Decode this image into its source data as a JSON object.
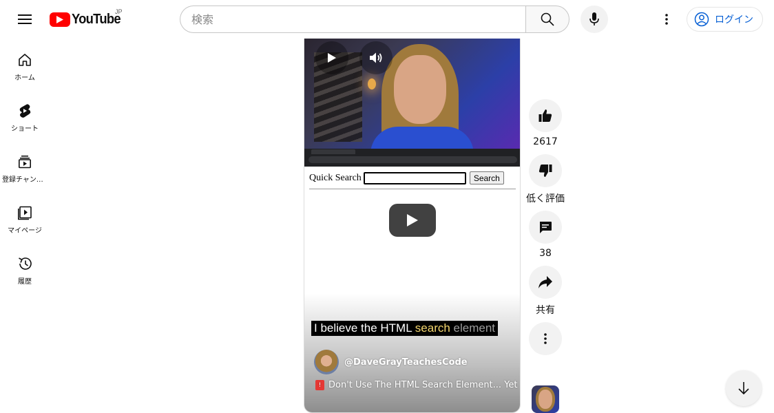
{
  "header": {
    "logo_text": "YouTube",
    "region": "JP",
    "search": {
      "placeholder": "検索",
      "value": ""
    },
    "login_label": "ログイン"
  },
  "sidebar": {
    "items": [
      {
        "label": "ホーム",
        "icon": "home-icon"
      },
      {
        "label": "ショート",
        "icon": "shorts-icon"
      },
      {
        "label": "登録チャンネル",
        "icon": "subscriptions-icon"
      },
      {
        "label": "マイページ",
        "icon": "library-icon"
      },
      {
        "label": "履歴",
        "icon": "history-icon"
      }
    ]
  },
  "player": {
    "embedded_page": {
      "label": "Quick Search",
      "button": "Search"
    },
    "caption": {
      "part1": "I believe the HTML ",
      "part2": "search",
      "part3": " element"
    },
    "channel": "@DaveGrayTeachesCode",
    "title": "Don't Use The HTML Search Element... Yet"
  },
  "actions": {
    "likes": "2617",
    "dislike_label": "低く評価",
    "comments": "38",
    "share_label": "共有"
  },
  "colors": {
    "brand_red": "#ff0000",
    "link_blue": "#065fd4"
  }
}
